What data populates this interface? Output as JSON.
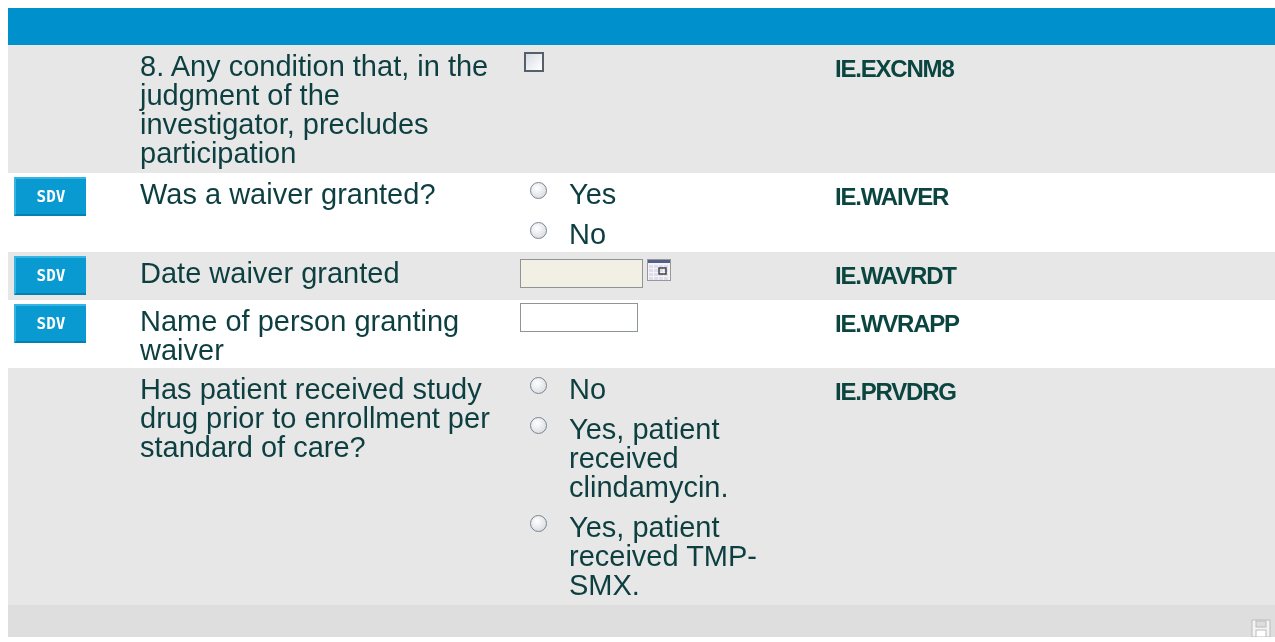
{
  "rows": [
    {
      "label": "8. Any condition that, in the judgment of the investigator, precludes participation",
      "kind": "checkbox",
      "checked": false,
      "code": "IE.EXCNM8"
    },
    {
      "sdv": "SDV",
      "label": "Was a waiver granted?",
      "kind": "radio",
      "options": [
        {
          "label": "Yes",
          "selected": false
        },
        {
          "label": "No",
          "selected": false
        }
      ],
      "code": "IE.WAIVER"
    },
    {
      "sdv": "SDV",
      "label": "Date waiver granted",
      "kind": "date",
      "disabled": true,
      "code": "IE.WAVRDT"
    },
    {
      "sdv": "SDV",
      "label": "Name of person granting waiver",
      "kind": "text",
      "code": "IE.WVRAPP"
    },
    {
      "label": "Has patient received study drug prior to enrollment per standard of care?",
      "kind": "radio",
      "options": [
        {
          "label": "No",
          "selected": false
        },
        {
          "label": "Yes, patient received clindamycin.",
          "selected": false
        },
        {
          "label": "Yes, patient received TMP-SMX.",
          "selected": false
        }
      ],
      "code": "IE.PRVDRG"
    }
  ]
}
